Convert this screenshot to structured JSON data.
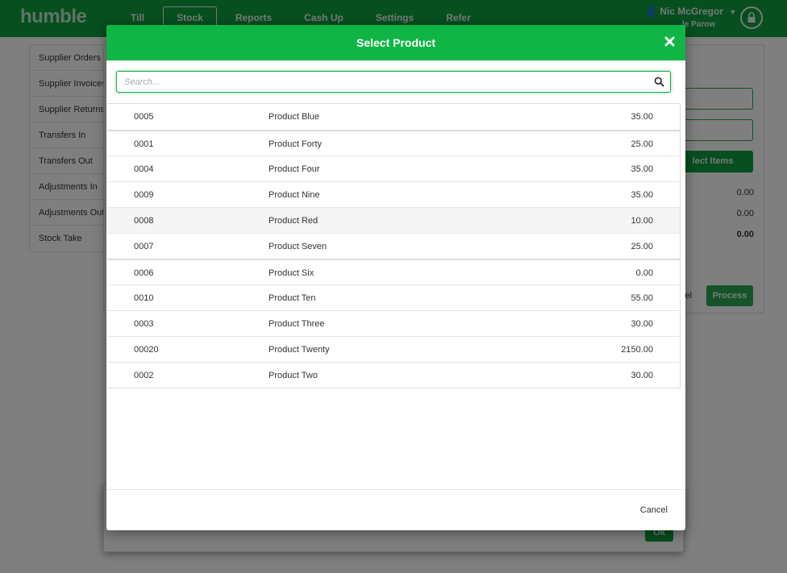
{
  "app": {
    "logo": "humble",
    "nav": [
      "Till",
      "Stock",
      "Reports",
      "Cash Up",
      "Settings",
      "Refer"
    ],
    "active_nav": 1,
    "user_name": "Nic McGregor",
    "user_location": "le Parow"
  },
  "sidebar": {
    "items": [
      {
        "label": "Supplier Orders"
      },
      {
        "label": "Supplier Invoices"
      },
      {
        "label": "Supplier Returns"
      },
      {
        "label": "Transfers In"
      },
      {
        "label": "Transfers Out"
      },
      {
        "label": "Adjustments In"
      },
      {
        "label": "Adjustments Out"
      },
      {
        "label": "Stock Take"
      }
    ]
  },
  "background_panel": {
    "select_items_label": "lect Items",
    "values": [
      "0.00",
      "0.00",
      "0.00"
    ],
    "cancel_label": "cel",
    "process_label": "Process",
    "ok_label": "Ok"
  },
  "modal": {
    "title": "Select Product",
    "search_placeholder": "Search...",
    "cancel_label": "Cancel",
    "colors": {
      "header": "#0fb646",
      "accent": "#1aa94b"
    },
    "products": [
      {
        "code": "0005",
        "name": "Product Blue",
        "price": "35.00"
      },
      {
        "code": "0001",
        "name": "Product Forty",
        "price": "25.00"
      },
      {
        "code": "0004",
        "name": "Product Four",
        "price": "35.00"
      },
      {
        "code": "0009",
        "name": "Product Nine",
        "price": "35.00"
      },
      {
        "code": "0008",
        "name": "Product Red",
        "price": "10.00"
      },
      {
        "code": "0007",
        "name": "Product Seven",
        "price": "25.00"
      },
      {
        "code": "0006",
        "name": "Product Six",
        "price": "0.00"
      },
      {
        "code": "0010",
        "name": "Product Ten",
        "price": "55.00"
      },
      {
        "code": "0003",
        "name": "Product Three",
        "price": "30.00"
      },
      {
        "code": "00020",
        "name": "Product Twenty",
        "price": "2150.00"
      },
      {
        "code": "0002",
        "name": "Product Two",
        "price": "30.00"
      }
    ]
  }
}
